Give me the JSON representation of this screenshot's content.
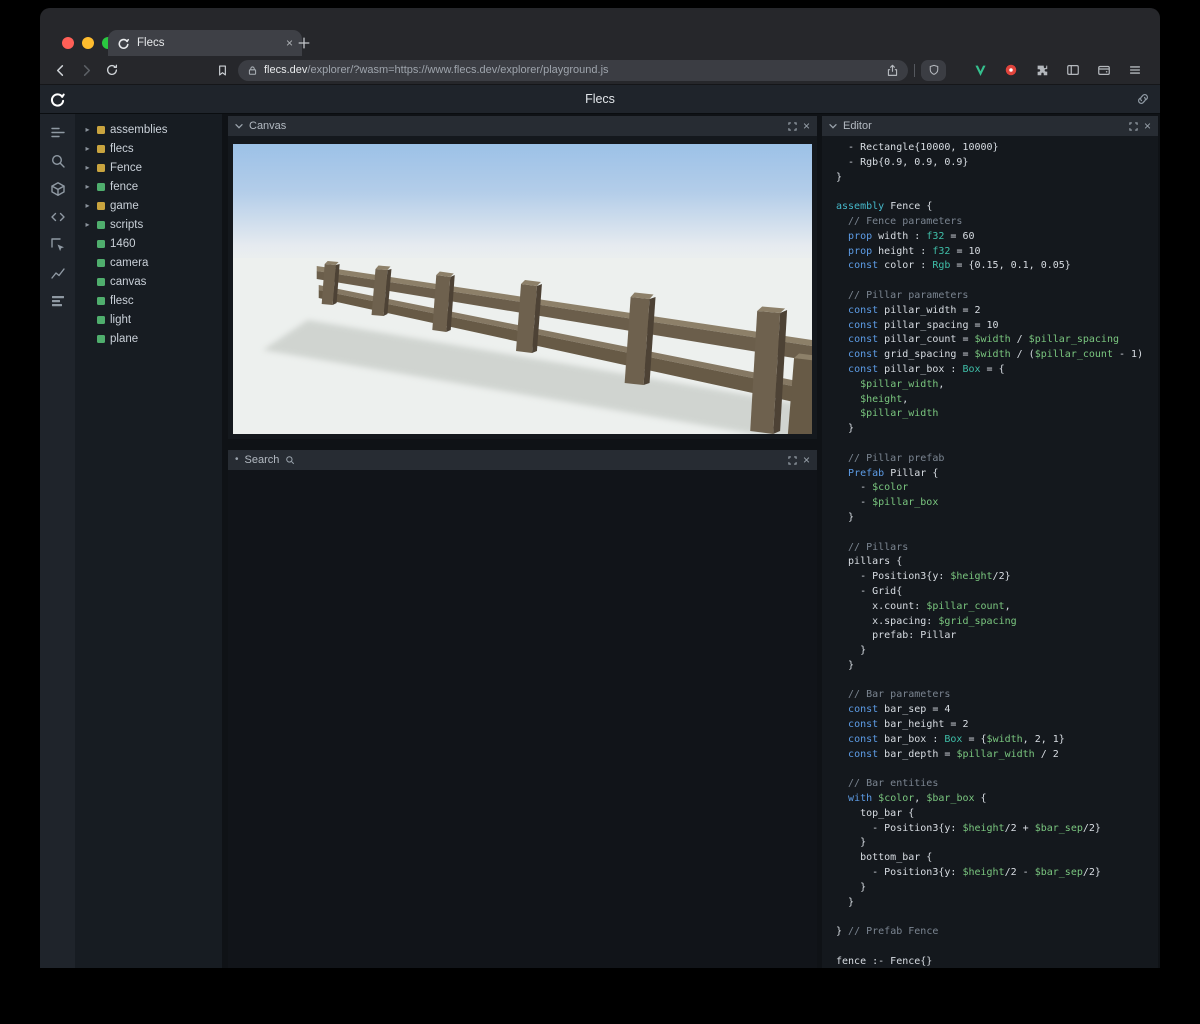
{
  "browser": {
    "traffic_lights": [
      "#ff5f57",
      "#febc2e",
      "#2ac840"
    ],
    "tab": {
      "title": "Flecs",
      "close_glyph": "×"
    },
    "url_host": "flecs.dev",
    "url_rest": "/explorer/?wasm=https://www.flecs.dev/explorer/playground.js"
  },
  "app": {
    "header": {
      "title": "Flecs"
    },
    "sidebar_icons": [
      {
        "name": "outliner-icon"
      },
      {
        "name": "search-icon"
      },
      {
        "name": "entities-icon"
      },
      {
        "name": "code-icon"
      },
      {
        "name": "inspect-icon"
      },
      {
        "name": "chart-icon"
      },
      {
        "name": "rows-icon"
      }
    ],
    "tree": {
      "items": [
        {
          "label": "assemblies",
          "color": "#c9a43f",
          "expandable": true
        },
        {
          "label": "flecs",
          "color": "#c9a43f",
          "expandable": true
        },
        {
          "label": "Fence",
          "color": "#c9a43f",
          "expandable": true
        },
        {
          "label": "fence",
          "color": "#4fae6d",
          "expandable": true
        },
        {
          "label": "game",
          "color": "#c9a43f",
          "expandable": true
        },
        {
          "label": "scripts",
          "color": "#4fae6d",
          "expandable": true
        },
        {
          "label": "1460",
          "color": "#4fae6d",
          "expandable": false
        },
        {
          "label": "camera",
          "color": "#4fae6d",
          "expandable": false
        },
        {
          "label": "canvas",
          "color": "#4fae6d",
          "expandable": false
        },
        {
          "label": "flesc",
          "color": "#4fae6d",
          "expandable": false
        },
        {
          "label": "light",
          "color": "#4fae6d",
          "expandable": false
        },
        {
          "label": "plane",
          "color": "#4fae6d",
          "expandable": false
        }
      ]
    },
    "panels": {
      "canvas": {
        "title": "Canvas"
      },
      "search": {
        "title": "Search"
      },
      "editor": {
        "title": "Editor"
      }
    },
    "editor_code": [
      [
        [
          "p",
          "  - Rectangle{10000, 10000}"
        ]
      ],
      [
        [
          "p",
          "  - Rgb{0.9, 0.9, 0.9}"
        ]
      ],
      [
        [
          "p",
          "}"
        ]
      ],
      [],
      [
        [
          "k2",
          "assembly"
        ],
        [
          "p",
          " Fence {"
        ]
      ],
      [
        [
          "c",
          "  // Fence parameters"
        ]
      ],
      [
        [
          "p",
          "  "
        ],
        [
          "k",
          "prop"
        ],
        [
          "p",
          " width : "
        ],
        [
          "t",
          "f32"
        ],
        [
          "p",
          " = 60"
        ]
      ],
      [
        [
          "p",
          "  "
        ],
        [
          "k",
          "prop"
        ],
        [
          "p",
          " height : "
        ],
        [
          "t",
          "f32"
        ],
        [
          "p",
          " = 10"
        ]
      ],
      [
        [
          "p",
          "  "
        ],
        [
          "k",
          "const"
        ],
        [
          "p",
          " color : "
        ],
        [
          "t",
          "Rgb"
        ],
        [
          "p",
          " = {0.15, 0.1, 0.05}"
        ]
      ],
      [],
      [
        [
          "c",
          "  // Pillar parameters"
        ]
      ],
      [
        [
          "p",
          "  "
        ],
        [
          "k",
          "const"
        ],
        [
          "p",
          " pillar_width = 2"
        ]
      ],
      [
        [
          "p",
          "  "
        ],
        [
          "k",
          "const"
        ],
        [
          "p",
          " pillar_spacing = 10"
        ]
      ],
      [
        [
          "p",
          "  "
        ],
        [
          "k",
          "const"
        ],
        [
          "p",
          " pillar_count = "
        ],
        [
          "v",
          "$width"
        ],
        [
          "p",
          " / "
        ],
        [
          "v",
          "$pillar_spacing"
        ]
      ],
      [
        [
          "p",
          "  "
        ],
        [
          "k",
          "const"
        ],
        [
          "p",
          " grid_spacing = "
        ],
        [
          "v",
          "$width"
        ],
        [
          "p",
          " / ("
        ],
        [
          "v",
          "$pillar_count"
        ],
        [
          "p",
          " - 1)"
        ]
      ],
      [
        [
          "p",
          "  "
        ],
        [
          "k",
          "const"
        ],
        [
          "p",
          " pillar_box : "
        ],
        [
          "t",
          "Box"
        ],
        [
          "p",
          " = {"
        ]
      ],
      [
        [
          "p",
          "    "
        ],
        [
          "v",
          "$pillar_width"
        ],
        [
          "p",
          ","
        ]
      ],
      [
        [
          "p",
          "    "
        ],
        [
          "v",
          "$height"
        ],
        [
          "p",
          ","
        ]
      ],
      [
        [
          "p",
          "    "
        ],
        [
          "v",
          "$pillar_width"
        ]
      ],
      [
        [
          "p",
          "  }"
        ]
      ],
      [],
      [
        [
          "c",
          "  // Pillar prefab"
        ]
      ],
      [
        [
          "p",
          "  "
        ],
        [
          "k",
          "Prefab"
        ],
        [
          "p",
          " Pillar {"
        ]
      ],
      [
        [
          "p",
          "    - "
        ],
        [
          "v",
          "$color"
        ]
      ],
      [
        [
          "p",
          "    - "
        ],
        [
          "v",
          "$pillar_box"
        ]
      ],
      [
        [
          "p",
          "  }"
        ]
      ],
      [],
      [
        [
          "c",
          "  // Pillars"
        ]
      ],
      [
        [
          "p",
          "  pillars {"
        ]
      ],
      [
        [
          "p",
          "    - Position3{y: "
        ],
        [
          "v",
          "$height"
        ],
        [
          "p",
          "/2}"
        ]
      ],
      [
        [
          "p",
          "    - Grid{"
        ]
      ],
      [
        [
          "p",
          "      x.count: "
        ],
        [
          "v",
          "$pillar_count"
        ],
        [
          "p",
          ","
        ]
      ],
      [
        [
          "p",
          "      x.spacing: "
        ],
        [
          "v",
          "$grid_spacing"
        ]
      ],
      [
        [
          "p",
          "      prefab: Pillar"
        ]
      ],
      [
        [
          "p",
          "    }"
        ]
      ],
      [
        [
          "p",
          "  }"
        ]
      ],
      [],
      [
        [
          "c",
          "  // Bar parameters"
        ]
      ],
      [
        [
          "p",
          "  "
        ],
        [
          "k",
          "const"
        ],
        [
          "p",
          " bar_sep = 4"
        ]
      ],
      [
        [
          "p",
          "  "
        ],
        [
          "k",
          "const"
        ],
        [
          "p",
          " bar_height = 2"
        ]
      ],
      [
        [
          "p",
          "  "
        ],
        [
          "k",
          "const"
        ],
        [
          "p",
          " bar_box : "
        ],
        [
          "t",
          "Box"
        ],
        [
          "p",
          " = {"
        ],
        [
          "v",
          "$width"
        ],
        [
          "p",
          ", 2, 1}"
        ]
      ],
      [
        [
          "p",
          "  "
        ],
        [
          "k",
          "const"
        ],
        [
          "p",
          " bar_depth = "
        ],
        [
          "v",
          "$pillar_width"
        ],
        [
          "p",
          " / 2"
        ]
      ],
      [],
      [
        [
          "c",
          "  // Bar entities"
        ]
      ],
      [
        [
          "p",
          "  "
        ],
        [
          "k",
          "with"
        ],
        [
          "p",
          " "
        ],
        [
          "v",
          "$color"
        ],
        [
          "p",
          ", "
        ],
        [
          "v",
          "$bar_box"
        ],
        [
          "p",
          " {"
        ]
      ],
      [
        [
          "p",
          "    top_bar {"
        ]
      ],
      [
        [
          "p",
          "      - Position3{y: "
        ],
        [
          "v",
          "$height"
        ],
        [
          "p",
          "/2 + "
        ],
        [
          "v",
          "$bar_sep"
        ],
        [
          "p",
          "/2}"
        ]
      ],
      [
        [
          "p",
          "    }"
        ]
      ],
      [
        [
          "p",
          "    bottom_bar {"
        ]
      ],
      [
        [
          "p",
          "      - Position3{y: "
        ],
        [
          "v",
          "$height"
        ],
        [
          "p",
          "/2 - "
        ],
        [
          "v",
          "$bar_sep"
        ],
        [
          "p",
          "/2}"
        ]
      ],
      [
        [
          "p",
          "    }"
        ]
      ],
      [
        [
          "p",
          "  }"
        ]
      ],
      [],
      [
        [
          "p",
          "} "
        ],
        [
          "c",
          "// Prefab Fence"
        ]
      ],
      [],
      [
        [
          "p",
          "fence :- Fence{}"
        ]
      ]
    ]
  }
}
